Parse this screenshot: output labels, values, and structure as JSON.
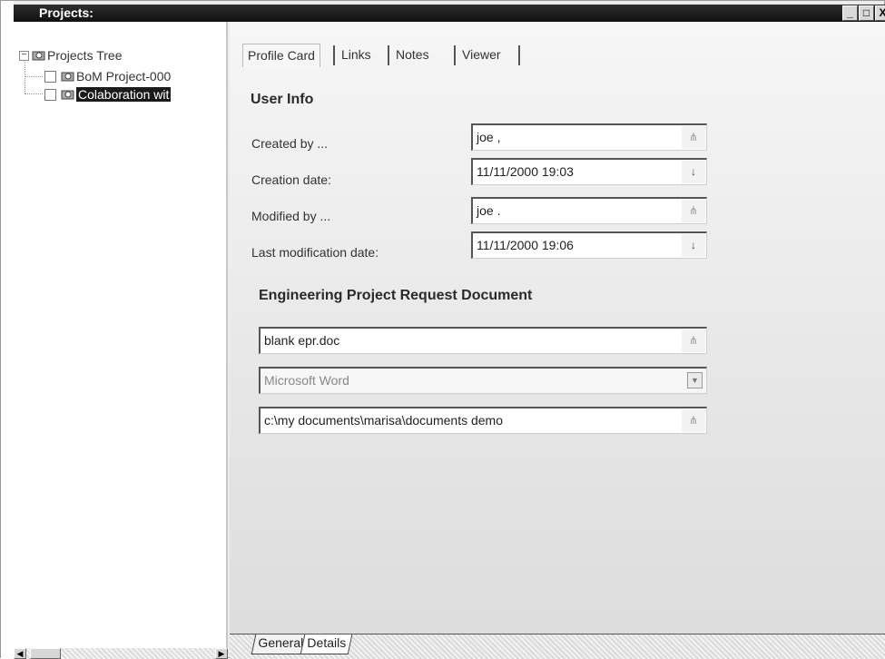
{
  "window": {
    "title": "Projects:",
    "controls": {
      "minimize": "_",
      "maximize": "□",
      "close": "X"
    }
  },
  "tree": {
    "root_label": "Projects Tree",
    "root_expander": "−",
    "items": [
      {
        "label": "BoM Project-000",
        "selected": false
      },
      {
        "label": "Colaboration wit",
        "selected": true
      }
    ]
  },
  "tabs": [
    "Profile Card",
    "Links",
    "Notes",
    "Viewer"
  ],
  "active_tab": "Profile Card",
  "user_info": {
    "title": "User Info",
    "fields": [
      {
        "label": "Created by ...",
        "value": "joe ,",
        "button": "search-icon"
      },
      {
        "label": "Creation date:",
        "value": "11/11/2000 19:03",
        "button": "dropdown-icon"
      },
      {
        "label": "Modified by ...",
        "value": "joe .",
        "button": "search-icon"
      },
      {
        "label": "Last modification date:",
        "value": "11/11/2000 19:06",
        "button": "dropdown-icon"
      }
    ]
  },
  "engineering_doc": {
    "title": "Engineering Project Request Document",
    "file_name": "blank epr.doc",
    "application": "Microsoft Word",
    "path": "c:\\my documents\\marisa\\documents demo"
  },
  "bottom_tabs": [
    "General",
    "Details"
  ],
  "active_bottom_tab": "Details"
}
